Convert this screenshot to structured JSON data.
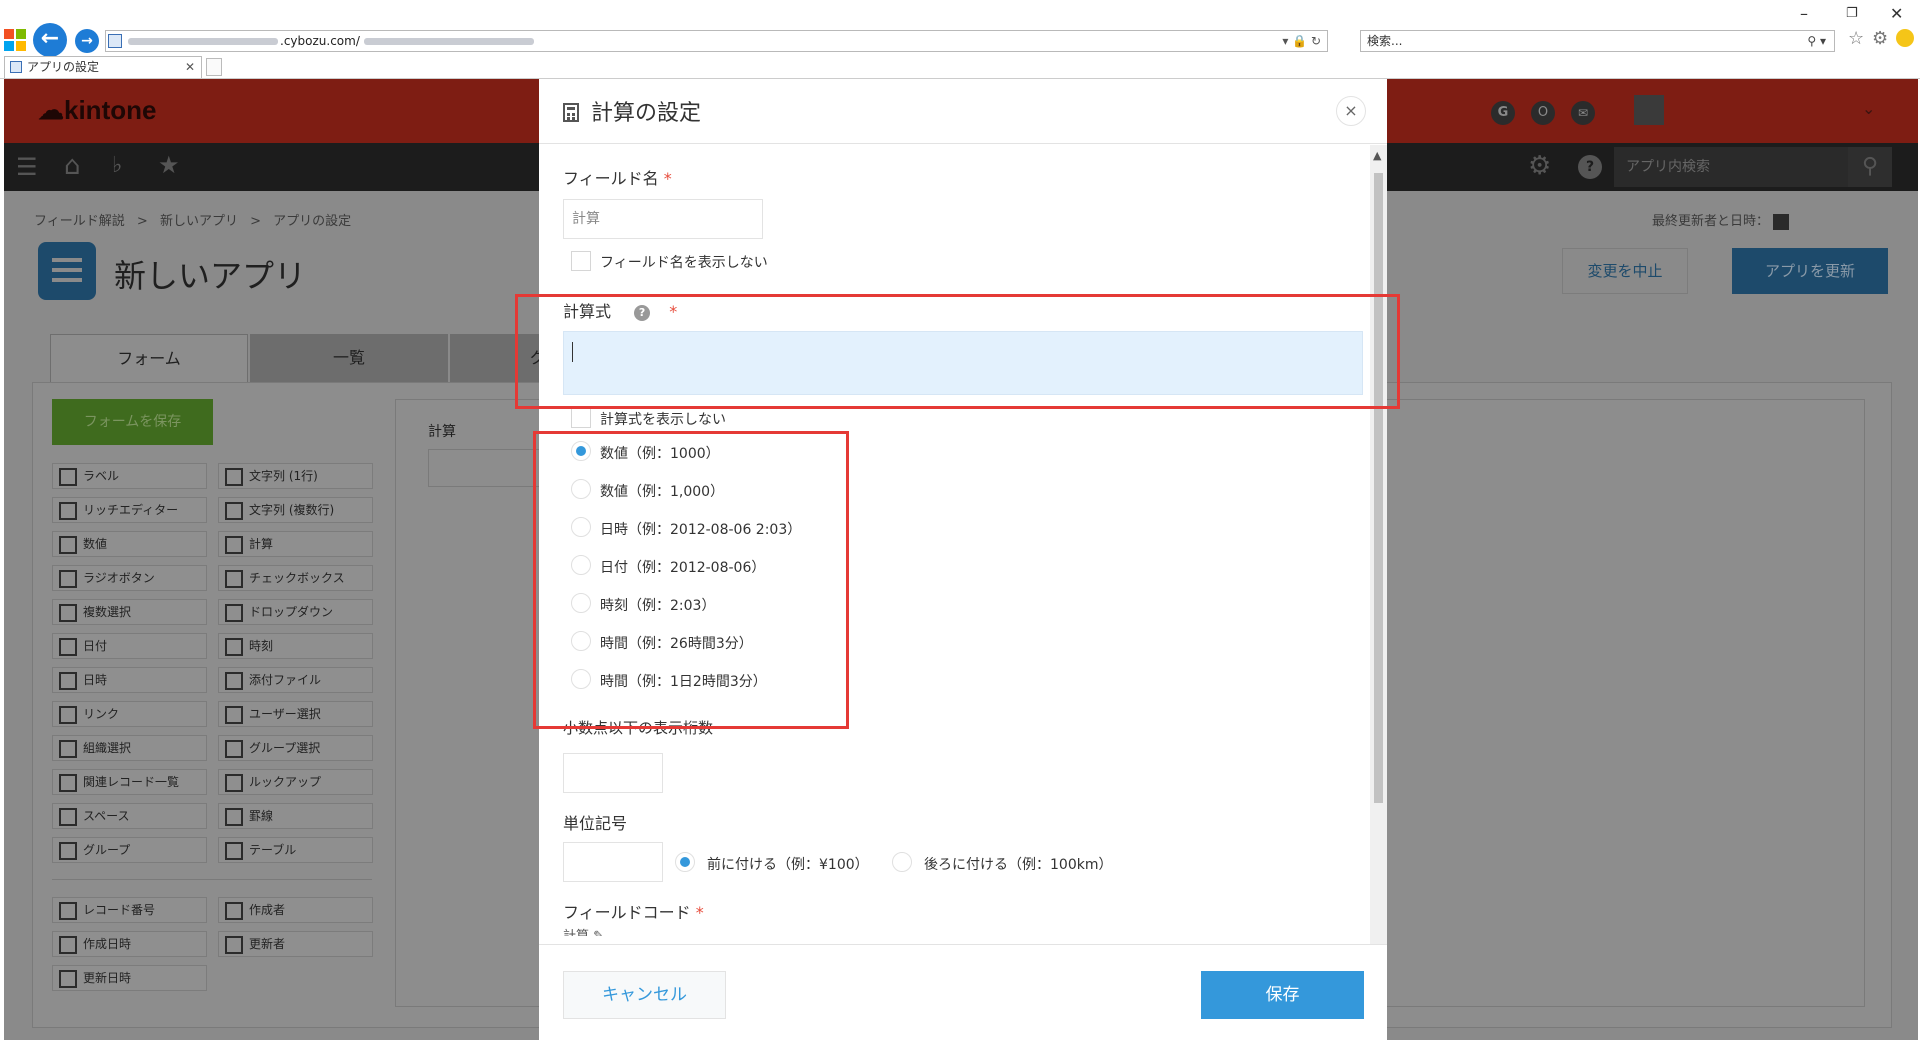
{
  "browser": {
    "url_domain": ".cybozu.com/",
    "search_placeholder": "検索...",
    "tab_title": "アプリの設定"
  },
  "kintone": {
    "logo": "kintone",
    "search_placeholder": "アプリ内検索",
    "breadcrumb": [
      "フィールド解説",
      "新しいアプリ",
      "アプリの設定"
    ],
    "breadcrumb_sep": ">",
    "last_updated_label": "最終更新者と日時：",
    "app_title": "新しいアプリ",
    "cancel_changes": "変更を中止",
    "update_app": "アプリを更新",
    "tabs": [
      "フォーム",
      "一覧",
      "グ"
    ],
    "save_form": "フォームを保存",
    "canvas_field_label": "計算",
    "palette": [
      [
        "ラベル",
        "文字列 (1行)"
      ],
      [
        "リッチエディター",
        "文字列 (複数行)"
      ],
      [
        "数値",
        "計算"
      ],
      [
        "ラジオボタン",
        "チェックボックス"
      ],
      [
        "複数選択",
        "ドロップダウン"
      ],
      [
        "日付",
        "時刻"
      ],
      [
        "日時",
        "添付ファイル"
      ],
      [
        "リンク",
        "ユーザー選択"
      ],
      [
        "組織選択",
        "グループ選択"
      ],
      [
        "関連レコード一覧",
        "ルックアップ"
      ],
      [
        "スペース",
        "罫線"
      ],
      [
        "グループ",
        "テーブル"
      ]
    ],
    "palette2": [
      [
        "レコード番号",
        "作成者"
      ],
      [
        "作成日時",
        "更新者"
      ],
      [
        "更新日時",
        ""
      ]
    ]
  },
  "modal": {
    "title": "計算の設定",
    "close": "×",
    "field_name_label": "フィールド名",
    "required_mark": "*",
    "field_name_value": "計算",
    "hide_field_name": "フィールド名を表示しない",
    "formula_label": "計算式",
    "formula_help": "?",
    "hide_formula": "計算式を表示しない",
    "format_options": [
      {
        "label": "数値（例：1000）",
        "selected": true
      },
      {
        "label": "数値（例：1,000）",
        "selected": false
      },
      {
        "label": "日時（例：2012-08-06 2:03）",
        "selected": false
      },
      {
        "label": "日付（例：2012-08-06）",
        "selected": false
      },
      {
        "label": "時刻（例：2:03）",
        "selected": false
      },
      {
        "label": "時間（例：26時間3分）",
        "selected": false
      },
      {
        "label": "時間（例：1日2時間3分）",
        "selected": false
      }
    ],
    "decimal_label": "小数点以下の表示桁数",
    "unit_label": "単位記号",
    "unit_before": "前に付ける（例：¥100）",
    "unit_after": "後ろに付ける（例：100km）",
    "field_code_label": "フィールドコード",
    "field_code_value": "計算",
    "cancel": "キャンセル",
    "save": "保存"
  },
  "colors": {
    "kintone_header": "#7e1d13",
    "primary_blue": "#3498db",
    "highlight_red": "#e53935",
    "formula_bg": "#e3f1fd"
  }
}
